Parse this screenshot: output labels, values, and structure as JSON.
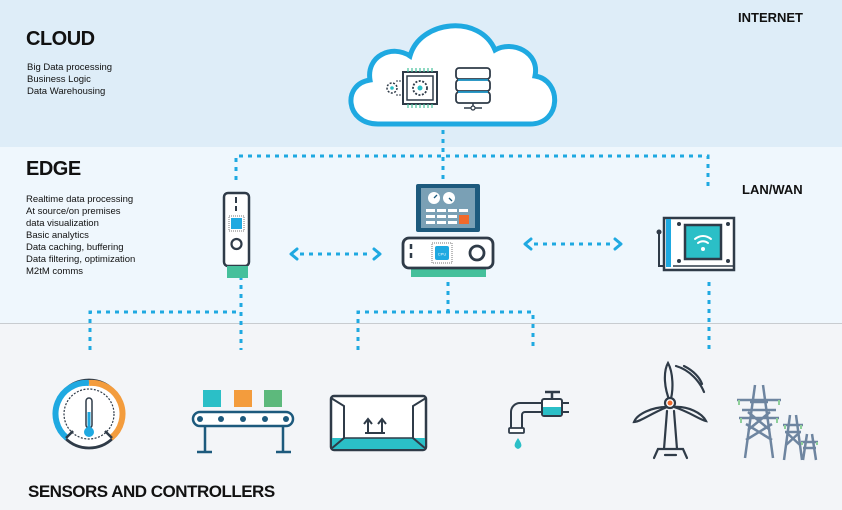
{
  "cloud": {
    "title": "CLOUD",
    "items": [
      "Big Data processing",
      "Business Logic",
      "Data Warehousing"
    ],
    "network_label": "INTERNET"
  },
  "edge": {
    "title": "EDGE",
    "items": [
      "Realtime data processing",
      "At source/on premises",
      "data visualization",
      "Basic analytics",
      "Data caching, buffering",
      "Data filtering, optimization",
      "M2tM comms"
    ],
    "network_label": "LAN/WAN",
    "gateway_cpu_label": "CPU"
  },
  "sensors": {
    "title": "SENSORS AND CONTROLLERS"
  },
  "colors": {
    "accent_blue": "#1fa9e1",
    "teal": "#2bbfc7",
    "green": "#45c09b",
    "orange": "#f39c3d",
    "dark": "#2f3b48",
    "navy": "#1d5a7d"
  }
}
